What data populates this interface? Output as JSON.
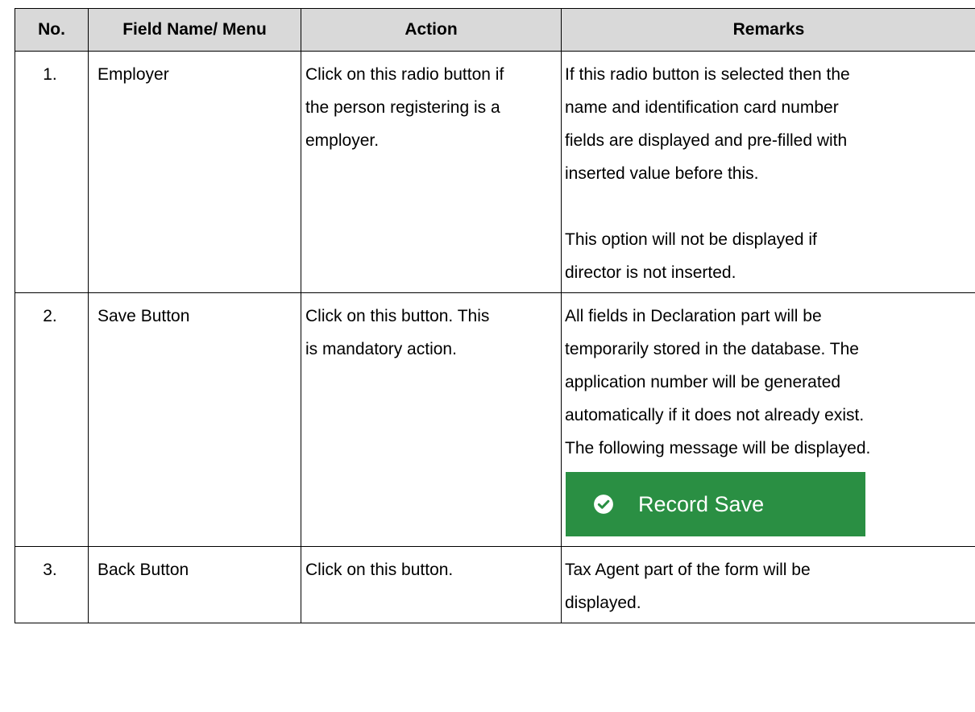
{
  "headers": {
    "no": "No.",
    "field": "Field Name/ Menu",
    "action": "Action",
    "remarks": "Remarks"
  },
  "rows": [
    {
      "no": "1.",
      "field": "Employer",
      "action_lines": [
        "Click on this radio button if",
        "the person registering is a",
        "employer."
      ],
      "remarks_lines": [
        "If this radio button is selected then the",
        "name and identification card number",
        "fields are displayed and pre-filled with",
        "inserted value before this."
      ],
      "remarks_lines_2": [
        "This option will not be displayed if",
        "director is not inserted."
      ]
    },
    {
      "no": "2.",
      "field": "Save Button",
      "action_lines": [
        "Click on this button. This",
        "is mandatory action."
      ],
      "remarks_lines": [
        "All fields in Declaration part will be",
        "temporarily stored in the database. The",
        "application number will be generated",
        "automatically if it does not already exist.",
        "The following message will be displayed."
      ],
      "toast": {
        "label": "Record Save",
        "icon": "check-circle-icon",
        "color": "#2a8f43"
      }
    },
    {
      "no": "3.",
      "field": "Back Button",
      "action_lines": [
        "Click on this button."
      ],
      "remarks_lines": [
        "Tax Agent part of the form will be",
        "displayed."
      ]
    }
  ]
}
